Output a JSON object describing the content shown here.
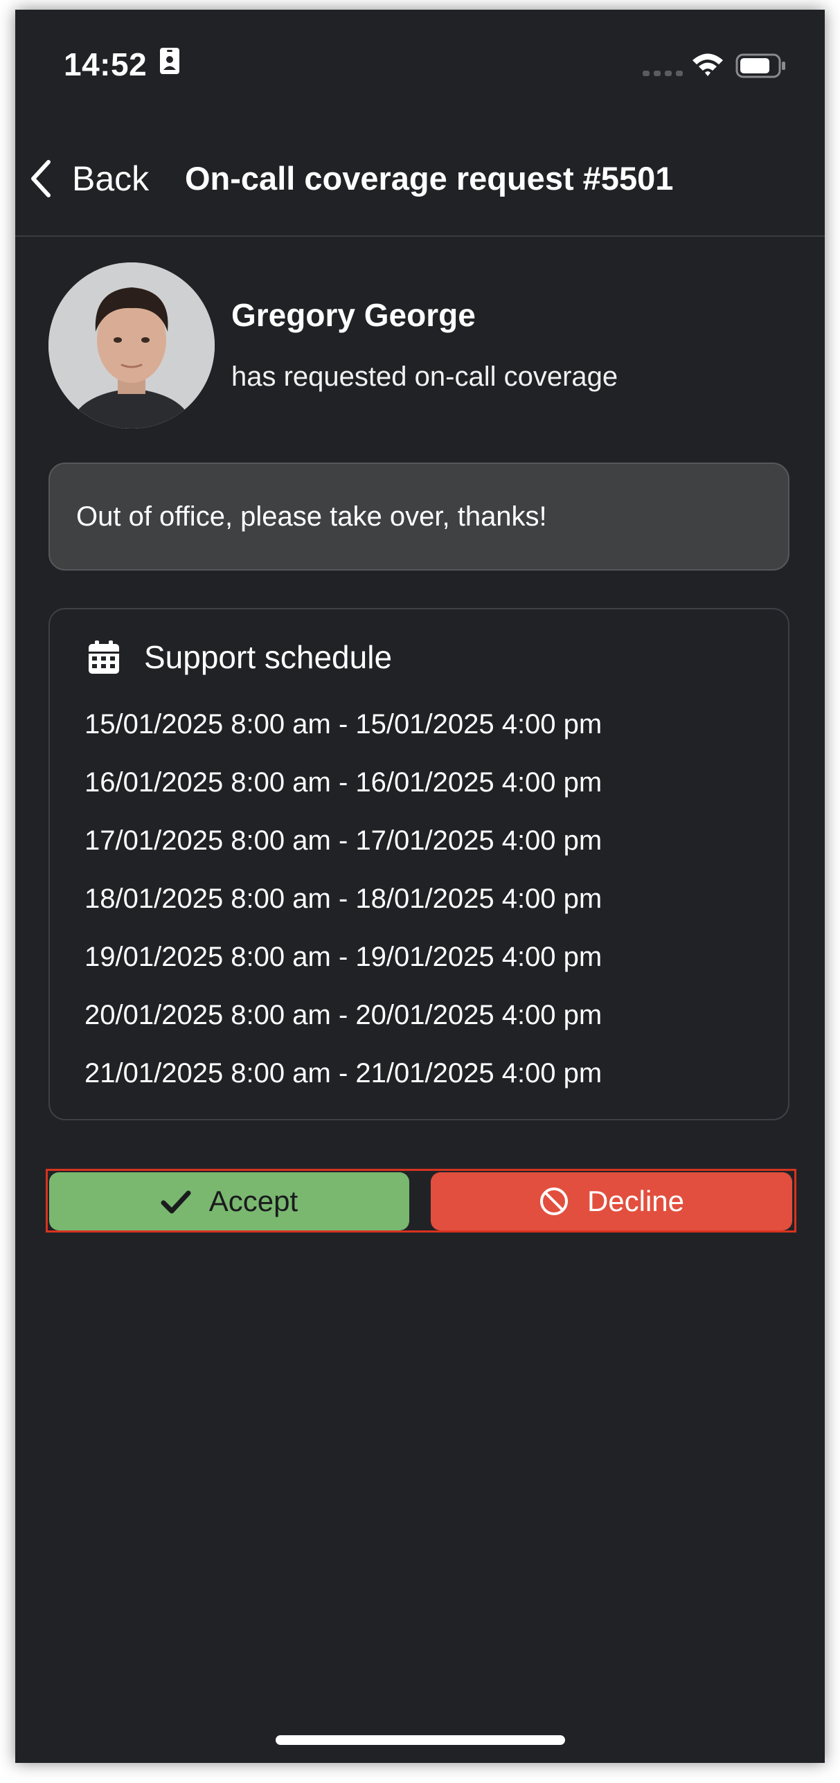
{
  "status_bar": {
    "time": "14:52"
  },
  "nav": {
    "back_label": "Back",
    "title": "On-call coverage request #5501"
  },
  "requester": {
    "name": "Gregory George",
    "subtitle": "has requested on-call coverage"
  },
  "message": {
    "text": "Out of office, please take over, thanks!"
  },
  "schedule": {
    "title": "Support schedule",
    "icon": "calendar-icon",
    "entries": [
      "15/01/2025 8:00 am - 15/01/2025 4:00 pm",
      "16/01/2025 8:00 am - 16/01/2025 4:00 pm",
      "17/01/2025 8:00 am - 17/01/2025 4:00 pm",
      "18/01/2025 8:00 am - 18/01/2025 4:00 pm",
      "19/01/2025 8:00 am - 19/01/2025 4:00 pm",
      "20/01/2025 8:00 am - 20/01/2025 4:00 pm",
      "21/01/2025 8:00 am - 21/01/2025 4:00 pm"
    ]
  },
  "actions": {
    "accept_label": "Accept",
    "accept_icon": "checkmark-icon",
    "accept_color": "#7ab870",
    "decline_label": "Decline",
    "decline_icon": "ban-icon",
    "decline_color": "#e24f3e",
    "highlight_color": "#d7331f"
  },
  "theme": {
    "background": "#212226",
    "message_background": "#404143"
  }
}
